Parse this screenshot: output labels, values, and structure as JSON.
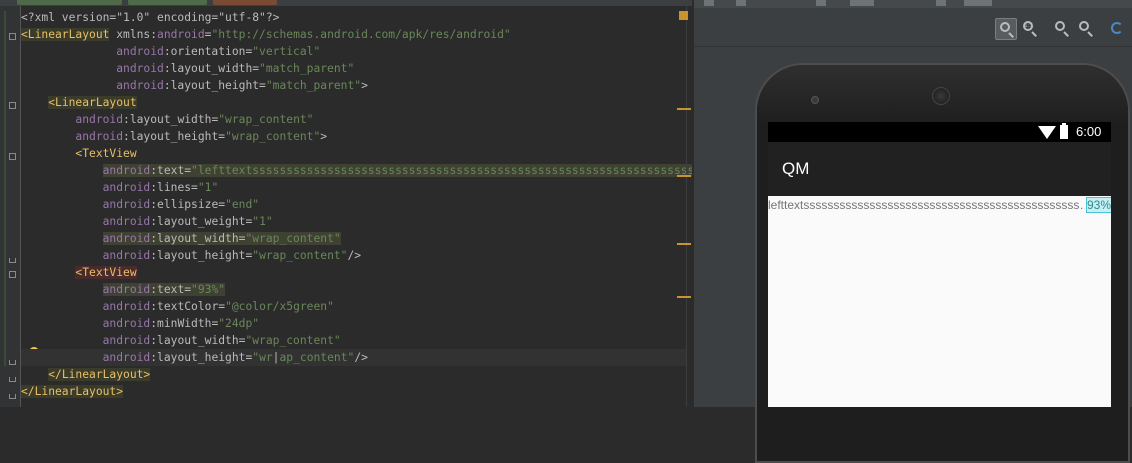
{
  "editor": {
    "lines": [
      {
        "indent": "",
        "parts": [
          [
            "pi",
            "<?xml version=\"1.0\" encoding=\"utf-8\"?>"
          ]
        ]
      },
      {
        "indent": "",
        "parts": [
          [
            "tag-hl",
            "<LinearLayout"
          ],
          [
            "attr",
            " xmlns:"
          ],
          [
            "ns",
            "android"
          ],
          [
            "attr",
            "="
          ],
          [
            "val",
            "\"http://schemas.android.com/apk/res/android\""
          ]
        ]
      },
      {
        "indent": "              ",
        "parts": [
          [
            "ns",
            "android"
          ],
          [
            "attr",
            ":orientation="
          ],
          [
            "val",
            "\"vertical\""
          ]
        ]
      },
      {
        "indent": "              ",
        "parts": [
          [
            "ns",
            "android"
          ],
          [
            "attr",
            ":layout_width="
          ],
          [
            "val",
            "\"match_parent\""
          ]
        ]
      },
      {
        "indent": "              ",
        "parts": [
          [
            "ns",
            "android"
          ],
          [
            "attr",
            ":layout_height="
          ],
          [
            "val",
            "\"match_parent\""
          ],
          [
            "attr",
            ">"
          ]
        ]
      },
      {
        "indent": "    ",
        "parts": [
          [
            "tag-hl",
            "<LinearLayout"
          ]
        ]
      },
      {
        "indent": "        ",
        "parts": [
          [
            "ns",
            "android"
          ],
          [
            "attr",
            ":layout_width="
          ],
          [
            "val",
            "\"wrap_content\""
          ]
        ]
      },
      {
        "indent": "        ",
        "parts": [
          [
            "ns",
            "android"
          ],
          [
            "attr",
            ":layout_height="
          ],
          [
            "val",
            "\"wrap_content\""
          ],
          [
            "attr",
            ">"
          ]
        ]
      },
      {
        "indent": "        ",
        "parts": [
          [
            "tag",
            "<TextView"
          ]
        ]
      },
      {
        "indent": "            ",
        "parts": [
          [
            "ns-sel",
            "android"
          ],
          [
            "attr-sel",
            ":text="
          ],
          [
            "val-sel",
            "\"lefttextssssssssssssssssssssssssssssssssssssssssssssssssssssssssssssssssssssssssssssssss"
          ]
        ]
      },
      {
        "indent": "            ",
        "parts": [
          [
            "ns",
            "android"
          ],
          [
            "attr",
            ":lines="
          ],
          [
            "val",
            "\"1\""
          ]
        ]
      },
      {
        "indent": "            ",
        "parts": [
          [
            "ns",
            "android"
          ],
          [
            "attr",
            ":ellipsize="
          ],
          [
            "val",
            "\"end\""
          ]
        ]
      },
      {
        "indent": "            ",
        "parts": [
          [
            "ns",
            "android"
          ],
          [
            "attr",
            ":layout_weight="
          ],
          [
            "val",
            "\"1\""
          ]
        ]
      },
      {
        "indent": "            ",
        "parts": [
          [
            "ns-sel",
            "android"
          ],
          [
            "attr-sel",
            ":layout_width="
          ],
          [
            "val-sel",
            "\"wrap_content\""
          ]
        ]
      },
      {
        "indent": "            ",
        "parts": [
          [
            "ns",
            "android"
          ],
          [
            "attr",
            ":layout_height="
          ],
          [
            "val",
            "\"wrap_content\""
          ],
          [
            "attr",
            "/>"
          ]
        ]
      },
      {
        "indent": "        ",
        "parts": [
          [
            "tag-err",
            "<TextView"
          ]
        ]
      },
      {
        "indent": "            ",
        "parts": [
          [
            "ns-sel",
            "android"
          ],
          [
            "attr-sel",
            ":text="
          ],
          [
            "val-sel",
            "\"93%\""
          ]
        ]
      },
      {
        "indent": "            ",
        "parts": [
          [
            "ns",
            "android"
          ],
          [
            "attr",
            ":textColor="
          ],
          [
            "val",
            "\"@color/x5green\""
          ]
        ]
      },
      {
        "indent": "            ",
        "parts": [
          [
            "ns",
            "android"
          ],
          [
            "attr",
            ":minWidth="
          ],
          [
            "val",
            "\"24dp\""
          ]
        ]
      },
      {
        "indent": "            ",
        "parts": [
          [
            "ns",
            "android"
          ],
          [
            "attr",
            ":layout_width="
          ],
          [
            "val",
            "\"wrap_content\""
          ]
        ]
      },
      {
        "indent": "            ",
        "parts": [
          [
            "ns",
            "android"
          ],
          [
            "attr",
            ":layout_height="
          ],
          [
            "val",
            "\"wr"
          ],
          [
            "attr",
            "|"
          ],
          [
            "val",
            "ap_content\""
          ],
          [
            "attr",
            "/>"
          ]
        ]
      },
      {
        "indent": "    ",
        "parts": [
          [
            "tag-hl",
            "</LinearLayout>"
          ]
        ]
      },
      {
        "indent": "",
        "parts": [
          [
            "tag-hl",
            "</LinearLayout>"
          ]
        ]
      }
    ],
    "current_line": 20
  },
  "preview": {
    "toolbar_icons": [
      "zoom-fit-icon",
      "zoom-actual-icon",
      "zoom-in-icon",
      "zoom-out-icon",
      "refresh-icon"
    ],
    "zoom_actual_text": "1:1",
    "status_time": "6:00",
    "app_title": "QM",
    "left_text": "lefttextssssssssssssssssssssssssssssssssssssssssssssss…",
    "percent_text": "93%"
  },
  "colors": {
    "editor_bg": "#2b2b2b",
    "tag": "#e8bf6a",
    "attribute_value": "#6a8759",
    "namespace": "#9876aa",
    "percent_text": "#2e8b8b",
    "accent_marker": "#c9932d"
  }
}
